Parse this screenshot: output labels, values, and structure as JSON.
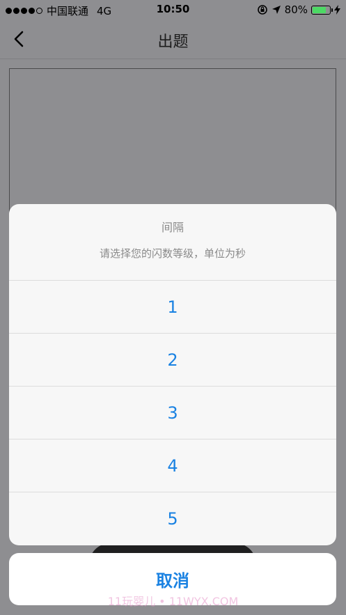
{
  "status_bar": {
    "carrier": "中国联通",
    "network": "4G",
    "time": "10:50",
    "battery_percent": 80,
    "battery_label": "80%"
  },
  "nav": {
    "title": "出题",
    "back_icon": "chevron-left-icon"
  },
  "action_sheet": {
    "title": "间隔",
    "message": "请选择您的闪数等级，单位为秒",
    "options": [
      "1",
      "2",
      "3",
      "4",
      "5"
    ],
    "cancel_label": "取消"
  },
  "watermark": "11玩婴儿 • 11WYX.COM",
  "colors": {
    "accent": "#1a82e2",
    "battery_fill": "#4cd964",
    "overlay": "#8e8e91"
  }
}
